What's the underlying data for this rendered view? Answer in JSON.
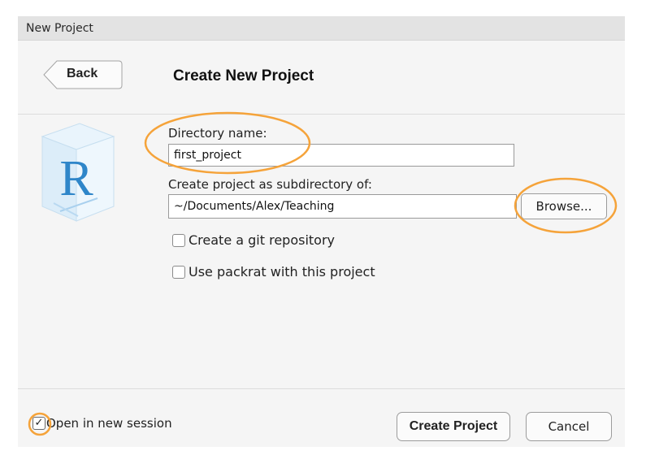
{
  "window": {
    "title": "New Project"
  },
  "header": {
    "back_label": "Back",
    "page_title": "Create New Project"
  },
  "form": {
    "directory_name_label": "Directory name:",
    "directory_name_value": "first_project",
    "subdirectory_label": "Create project as subdirectory of:",
    "subdirectory_value": "~/Documents/Alex/Teaching",
    "browse_label": "Browse...",
    "git_checkbox": {
      "label": "Create a git repository",
      "checked": false
    },
    "packrat_checkbox": {
      "label": "Use packrat with this project",
      "checked": false
    }
  },
  "footer": {
    "open_session": {
      "label": "Open in new session",
      "checked": true,
      "check_glyph": "✓"
    },
    "create_label": "Create Project",
    "cancel_label": "Cancel"
  },
  "icons": {
    "logo": "r-cube-logo-icon",
    "back": "back-arrow-icon"
  },
  "colors": {
    "highlight": "#f5a33a",
    "logo_blue": "#2f86c9"
  }
}
